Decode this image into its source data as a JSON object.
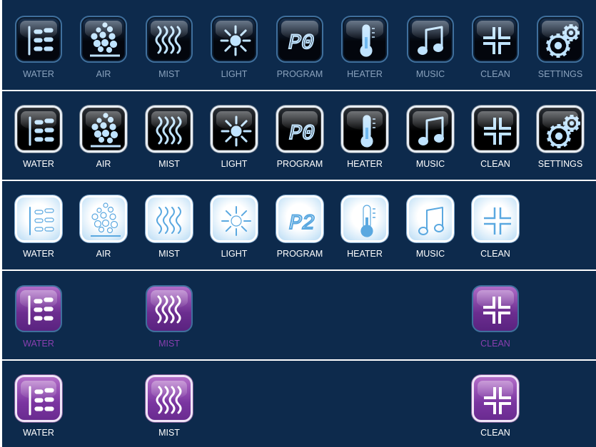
{
  "rows": [
    {
      "style": "off",
      "labels": [
        "WATER",
        "AIR",
        "MIST",
        "LIGHT",
        "PROGRAM",
        "HEATER",
        "MUSIC",
        "CLEAN",
        "SETTINGS"
      ]
    },
    {
      "style": "on",
      "labels": [
        "WATER",
        "AIR",
        "MIST",
        "LIGHT",
        "PROGRAM",
        "HEATER",
        "MUSIC",
        "CLEAN",
        "SETTINGS"
      ]
    },
    {
      "style": "light",
      "labels": [
        "WATER",
        "AIR",
        "MIST",
        "LIGHT",
        "PROGRAM",
        "HEATER",
        "MUSIC",
        "CLEAN"
      ]
    },
    {
      "style": "purple-dim",
      "labels": [
        "WATER",
        "MIST",
        "CLEAN"
      ]
    },
    {
      "style": "purple",
      "labels": [
        "WATER",
        "MIST",
        "CLEAN"
      ]
    }
  ],
  "program_display": {
    "dark": "P0",
    "light": "P2"
  },
  "colors": {
    "panel": "#0d2a4c",
    "label_dim": "#8aa2bd",
    "label_purple": "#8a3fb0",
    "glyph_blue": "#bfe3ff",
    "glyph_light": "#5aa8e0"
  }
}
